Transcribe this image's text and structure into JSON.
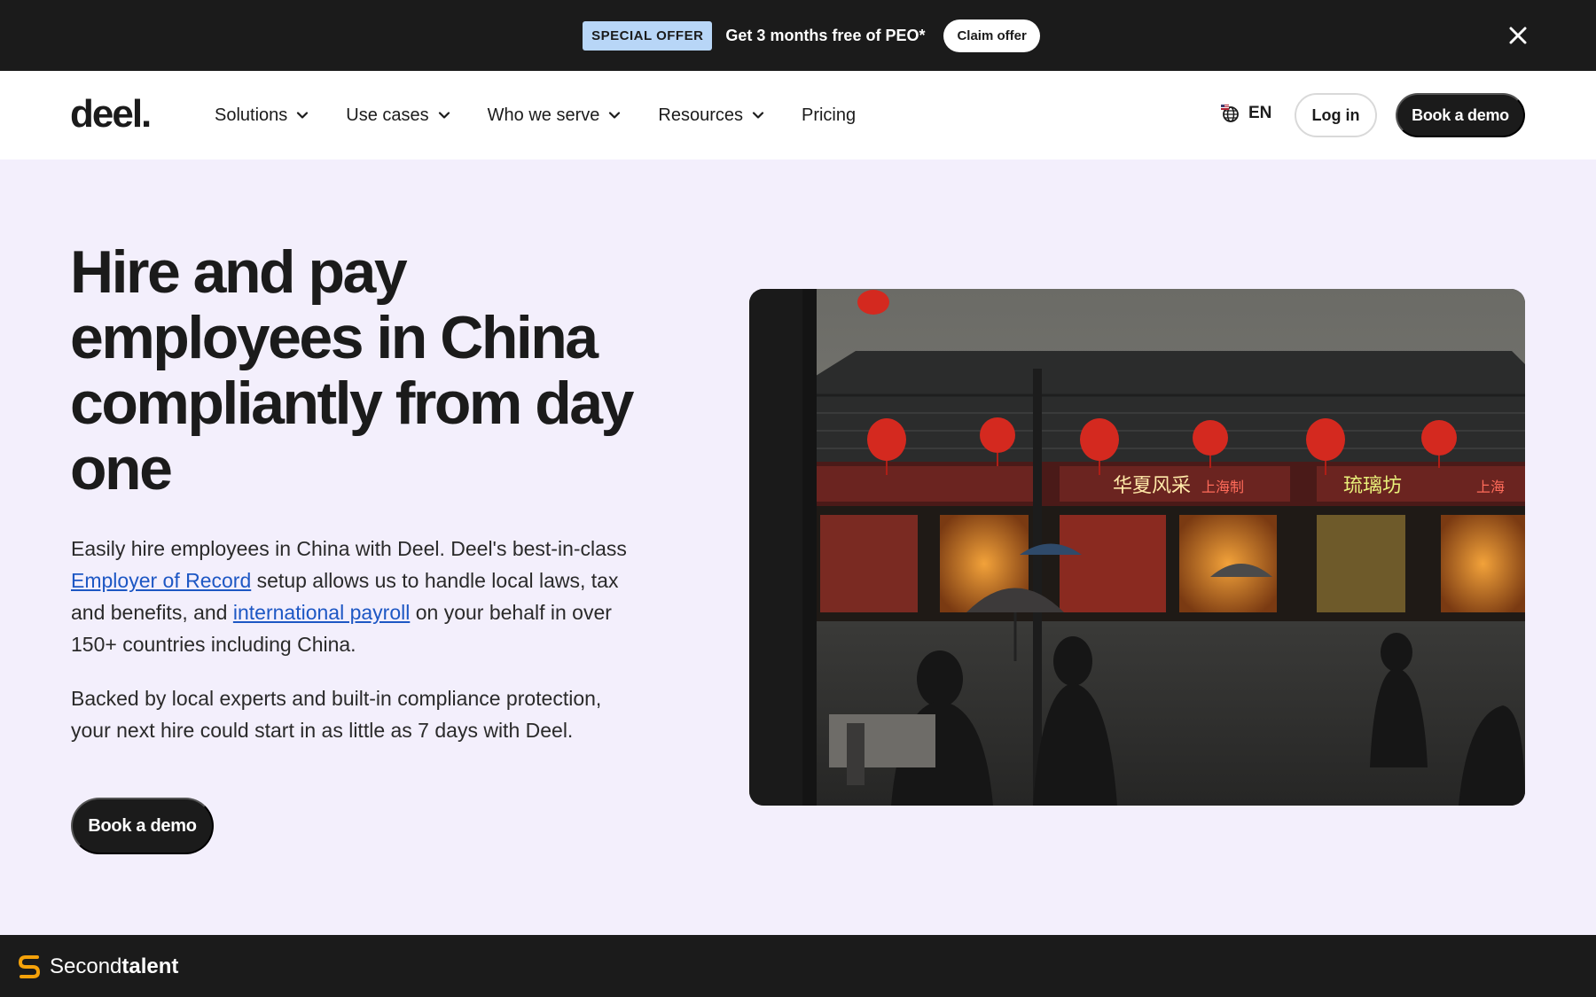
{
  "promo": {
    "badge": "SPECIAL OFFER",
    "text": "Get 3 months free of PEO*",
    "cta": "Claim offer"
  },
  "nav": {
    "logo": "deel.",
    "items": [
      {
        "label": "Solutions",
        "dropdown": true
      },
      {
        "label": "Use cases",
        "dropdown": true
      },
      {
        "label": "Who we serve",
        "dropdown": true
      },
      {
        "label": "Resources",
        "dropdown": true
      },
      {
        "label": "Pricing",
        "dropdown": false
      }
    ],
    "language": "EN",
    "login": "Log in",
    "demo": "Book a demo"
  },
  "hero": {
    "title": "Hire and pay employees in China compliantly from day one",
    "p1_a": "Easily hire employees in China with Deel. Deel's best-in-class ",
    "p1_link1": "Employer of Record",
    "p1_b": " setup allows us to handle local laws, tax and benefits, and ",
    "p1_link2": "international payroll",
    "p1_c": " on your behalf in over 150+ countries including China.",
    "p2": "Backed by local experts and built-in compliance protection, your next hire could start in as little as 7 days with Deel.",
    "cta": "Book a demo",
    "signs": [
      "华夏风采",
      "上海制",
      "琉璃坊",
      "上海"
    ]
  },
  "footer": {
    "brand_light": "Second",
    "brand_bold": "talent"
  },
  "colors": {
    "dark": "#1b1b1b",
    "hero_bg": "#f3effc",
    "badge": "#b8d6f7",
    "link": "#1d57c4",
    "brand_orange": "#f5a20a"
  }
}
